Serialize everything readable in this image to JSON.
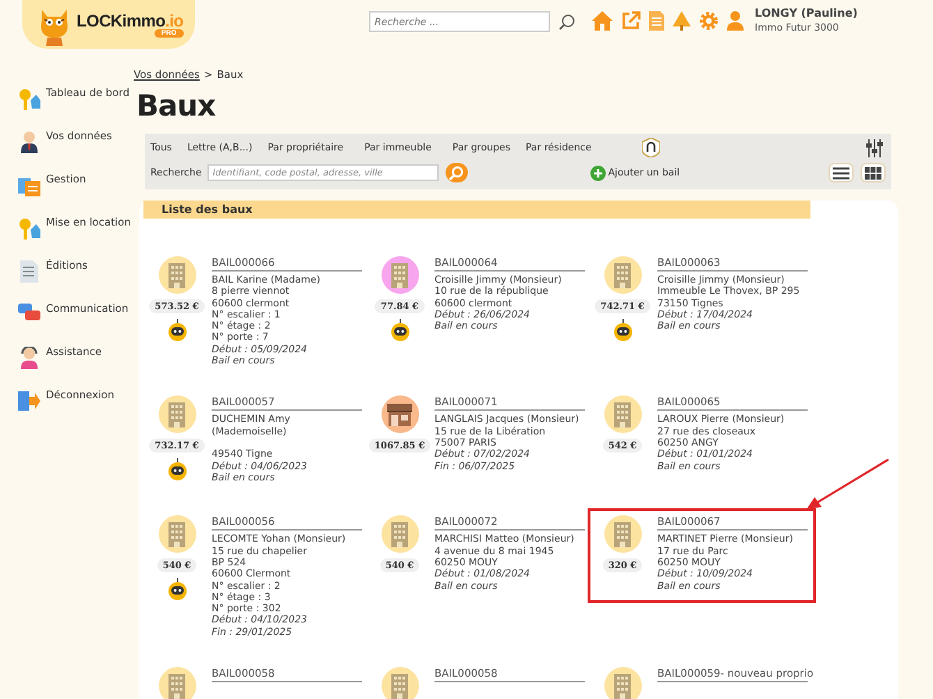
{
  "header": {
    "logo": "LOCKimmo",
    "logo_suffix": ".io",
    "logo_badge": "PRO",
    "search": {
      "placeholder": "Recherche ..."
    },
    "user": {
      "name": "LONGY (Pauline)",
      "agency": "Immo Futur 3000"
    }
  },
  "sidebar": {
    "items": [
      {
        "label": "Tableau de bord",
        "kind": "keys"
      },
      {
        "label": "Vos données",
        "kind": "person"
      },
      {
        "label": "Gestion",
        "kind": "folders"
      },
      {
        "label": "Mise en location",
        "kind": "keys"
      },
      {
        "label": "Éditions",
        "kind": "document"
      },
      {
        "label": "Communication",
        "kind": "chat"
      },
      {
        "label": "Assistance",
        "kind": "support"
      },
      {
        "label": "Déconnexion",
        "kind": "exit"
      }
    ]
  },
  "breadcrumb": {
    "link": "Vos données",
    "separator": ">",
    "current": "Baux"
  },
  "title": "Baux",
  "toolbar": {
    "filters": [
      "Tous",
      "Lettre (A,B...)",
      "Par propriétaire",
      "Par immeuble",
      "Par groupes",
      "Par résidence"
    ],
    "search_label": "Recherche",
    "search": {
      "placeholder": "Identifiant, code postal, adresse, ville"
    },
    "add_button": "Ajouter un bail"
  },
  "list": {
    "title": "Liste des baux",
    "leases": [
      {
        "id": "BAIL000066",
        "rent": "573.52 €",
        "kind": "building",
        "color": "#fde3a0",
        "robot": true,
        "highlighted": false,
        "lines": [
          {
            "kind": "name",
            "text": "BAIL Karine (Madame)"
          },
          {
            "kind": "plain",
            "text": "8 pierre viennot"
          },
          {
            "kind": "plain",
            "text": "60600 clermont"
          },
          {
            "kind": "plain",
            "text": "N° escalier : 1"
          },
          {
            "kind": "plain",
            "text": "N° étage : 2"
          },
          {
            "kind": "plain",
            "text": "N° porte : 7"
          },
          {
            "kind": "italic",
            "text": "Début : 05/09/2024"
          },
          {
            "kind": "italic",
            "text": "Bail en cours"
          }
        ]
      },
      {
        "id": "BAIL000064",
        "rent": "77.84 €",
        "kind": "building",
        "color": "#f7a6ee",
        "robot": true,
        "highlighted": false,
        "lines": [
          {
            "kind": "name",
            "text": "Croisille Jimmy (Monsieur)"
          },
          {
            "kind": "plain",
            "text": "10 rue de la république"
          },
          {
            "kind": "plain",
            "text": "60600 clermont"
          },
          {
            "kind": "italic",
            "text": "Début : 26/06/2024"
          },
          {
            "kind": "italic",
            "text": "Bail en cours"
          }
        ]
      },
      {
        "id": "BAIL000063",
        "rent": "742.71 €",
        "kind": "building",
        "color": "#fde3a0",
        "robot": true,
        "highlighted": false,
        "lines": [
          {
            "kind": "name",
            "text": "Croisille Jimmy (Monsieur)"
          },
          {
            "kind": "plain",
            "text": "Immeuble Le Thovex, BP 295"
          },
          {
            "kind": "plain",
            "text": "73150 Tignes"
          },
          {
            "kind": "italic",
            "text": "Début : 17/04/2024"
          },
          {
            "kind": "italic",
            "text": "Bail en cours"
          }
        ]
      },
      {
        "id": "BAIL000057",
        "rent": "732.17 €",
        "kind": "building",
        "color": "#fde3a0",
        "robot": true,
        "highlighted": false,
        "lines": [
          {
            "kind": "name",
            "text": "DUCHEMIN Amy (Mademoiselle)"
          },
          {
            "kind": "blank"
          },
          {
            "kind": "plain",
            "text": "49540 Tigne"
          },
          {
            "kind": "italic",
            "text": "Début : 04/06/2023"
          },
          {
            "kind": "italic",
            "text": "Bail en cours"
          }
        ]
      },
      {
        "id": "BAIL000071",
        "rent": "1067.85 €",
        "kind": "shop",
        "color": "#f9b98c",
        "robot": false,
        "highlighted": false,
        "lines": [
          {
            "kind": "name",
            "text": "LANGLAIS Jacques (Monsieur)"
          },
          {
            "kind": "plain",
            "text": "15 rue de la Libération"
          },
          {
            "kind": "plain",
            "text": "75007 PARIS"
          },
          {
            "kind": "italic",
            "text": "Début : 07/02/2024"
          },
          {
            "kind": "italic",
            "text": "Fin : 06/07/2025"
          }
        ]
      },
      {
        "id": "BAIL000065",
        "rent": "542 €",
        "kind": "building",
        "color": "#fde3a0",
        "robot": false,
        "highlighted": false,
        "lines": [
          {
            "kind": "name",
            "text": "LAROUX Pierre (Monsieur)"
          },
          {
            "kind": "plain",
            "text": "27 rue des closeaux"
          },
          {
            "kind": "plain",
            "text": "60250 ANGY"
          },
          {
            "kind": "italic",
            "text": "Début : 01/01/2024"
          },
          {
            "kind": "italic",
            "text": "Bail en cours"
          }
        ]
      },
      {
        "id": "BAIL000056",
        "rent": "540 €",
        "kind": "building",
        "color": "#fde3a0",
        "robot": true,
        "highlighted": false,
        "lines": [
          {
            "kind": "name",
            "text": "LECOMTE Yohan (Monsieur)"
          },
          {
            "kind": "plain",
            "text": "15 rue du chapelier"
          },
          {
            "kind": "plain",
            "text": "BP 524"
          },
          {
            "kind": "plain",
            "text": "60600 Clermont"
          },
          {
            "kind": "plain",
            "text": "N° escalier : 2"
          },
          {
            "kind": "plain",
            "text": "N° étage : 3"
          },
          {
            "kind": "plain",
            "text": "N° porte : 302"
          },
          {
            "kind": "italic",
            "text": "Début : 04/10/2023"
          },
          {
            "kind": "italic",
            "text": "Fin : 29/01/2025"
          }
        ]
      },
      {
        "id": "BAIL000072",
        "rent": "540 €",
        "kind": "building",
        "color": "#fde3a0",
        "robot": false,
        "highlighted": false,
        "lines": [
          {
            "kind": "name",
            "text": "MARCHISI Matteo (Monsieur)"
          },
          {
            "kind": "plain",
            "text": "4 avenue du 8 mai 1945"
          },
          {
            "kind": "plain",
            "text": "60250 MOUY"
          },
          {
            "kind": "italic",
            "text": "Début : 01/08/2024"
          },
          {
            "kind": "italic",
            "text": "Bail en cours"
          }
        ]
      },
      {
        "id": "BAIL000067",
        "rent": "320 €",
        "kind": "building",
        "color": "#fde3a0",
        "robot": false,
        "highlighted": true,
        "lines": [
          {
            "kind": "name",
            "text": "MARTINET Pierre (Monsieur)"
          },
          {
            "kind": "plain",
            "text": "17 rue du Parc"
          },
          {
            "kind": "plain",
            "text": "60250 MOUY"
          },
          {
            "kind": "italic",
            "text": "Début : 10/09/2024"
          },
          {
            "kind": "italic",
            "text": "Bail en cours"
          }
        ]
      },
      {
        "id": "BAIL000058",
        "kind": "building",
        "color": "#fde3a0",
        "robot": false,
        "highlighted": false
      },
      {
        "id": "BAIL000058",
        "kind": "building",
        "color": "#fde3a0",
        "robot": false,
        "highlighted": false
      },
      {
        "id": "BAIL000059- nouveau proprio",
        "kind": "building",
        "color": "#fde3a0",
        "robot": false,
        "highlighted": false
      }
    ]
  }
}
